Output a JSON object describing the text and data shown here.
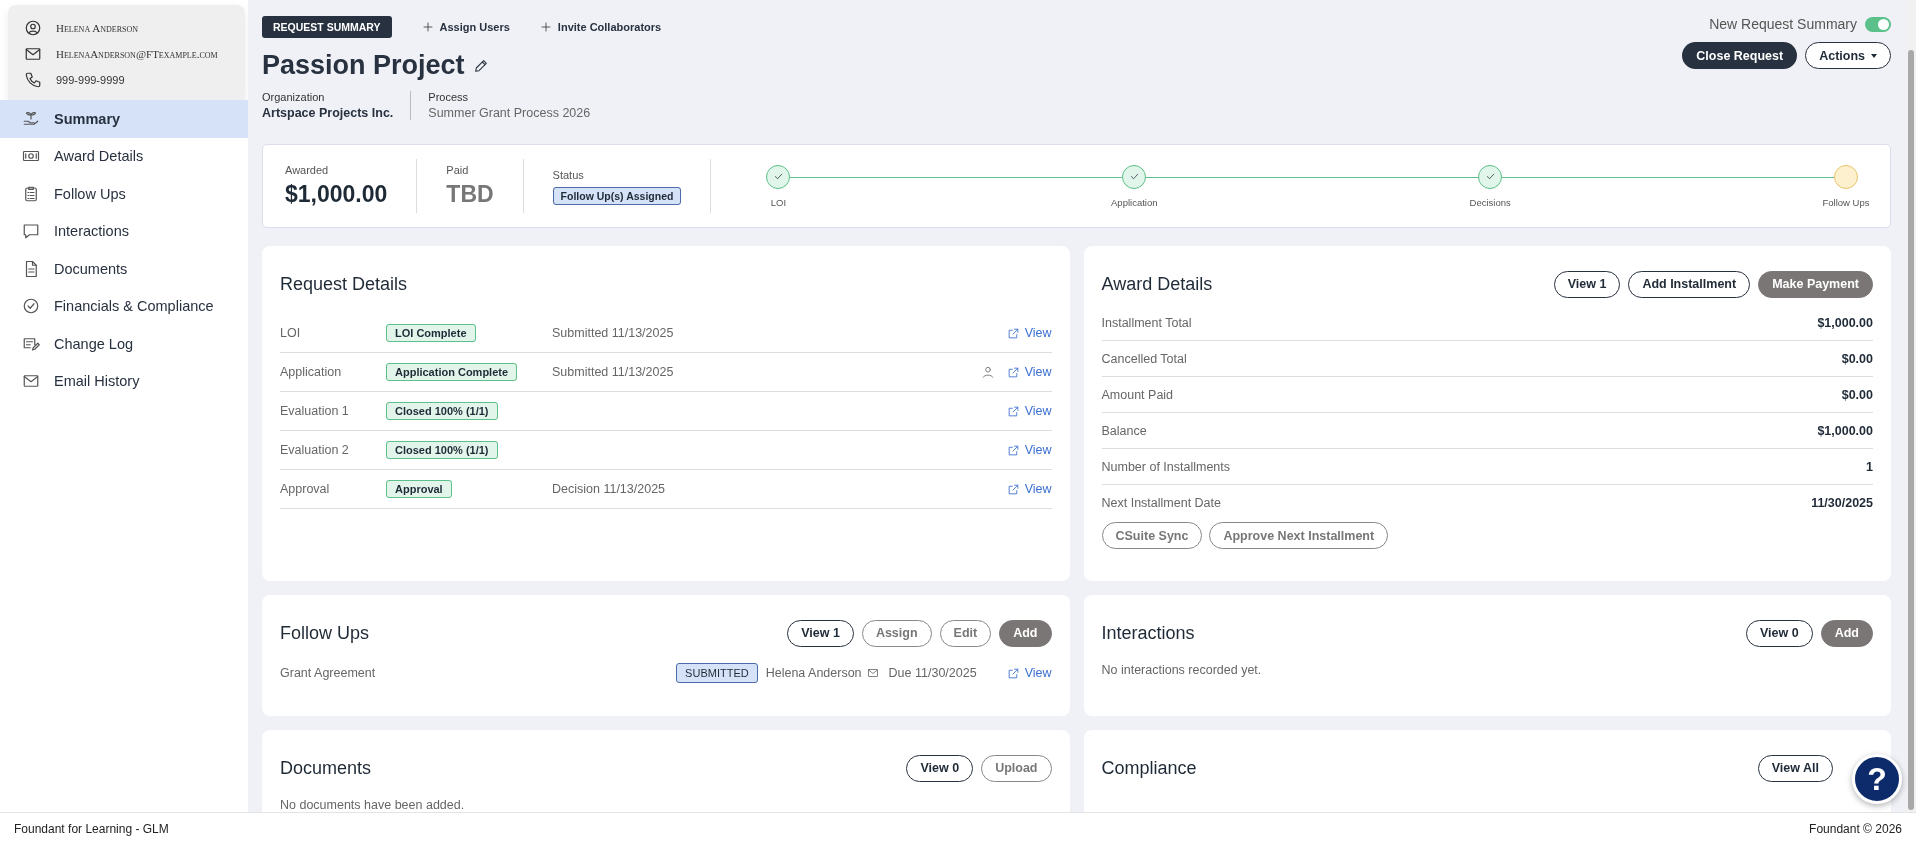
{
  "profile": {
    "name": "Helena Anderson",
    "email": "HelenaAnderson@FTexample.com",
    "phone": "999-999-9999"
  },
  "sidebar": {
    "items": [
      {
        "label": "Summary",
        "kind": "plant",
        "selected": true
      },
      {
        "label": "Award Details",
        "kind": "money",
        "selected": false
      },
      {
        "label": "Follow Ups",
        "kind": "clipboard",
        "selected": false
      },
      {
        "label": "Interactions",
        "kind": "chat",
        "selected": false
      },
      {
        "label": "Documents",
        "kind": "document",
        "selected": false
      },
      {
        "label": "Financials & Compliance",
        "kind": "check",
        "selected": false
      },
      {
        "label": "Change Log",
        "kind": "editlist",
        "selected": false
      },
      {
        "label": "Email History",
        "kind": "mail",
        "selected": false
      }
    ]
  },
  "header": {
    "badge": "REQUEST SUMMARY",
    "actions": [
      "Assign Users",
      "Invite Collaborators"
    ],
    "title": "Passion Project",
    "fields": [
      {
        "label": "Organization",
        "value": "Artspace Projects Inc.",
        "bold": true
      },
      {
        "label": "Process",
        "value": "Summer Grant Process 2026",
        "bold": false
      }
    ],
    "toggle": {
      "label": "New Request Summary",
      "on": true
    },
    "buttons": [
      {
        "label": "Close Request",
        "kind": "primary"
      },
      {
        "label": "Actions",
        "kind": "dropdown"
      }
    ]
  },
  "summary": {
    "stats": [
      {
        "label": "Awarded",
        "value": "$1,000.00",
        "muted": false
      },
      {
        "label": "Paid",
        "value": "TBD",
        "muted": true
      }
    ],
    "status": {
      "label": "Status",
      "badge": "Follow Up(s) Assigned"
    },
    "steps": [
      {
        "label": "LOI",
        "done": true,
        "current": false
      },
      {
        "label": "Application",
        "done": true,
        "current": false
      },
      {
        "label": "Decisions",
        "done": true,
        "current": false
      },
      {
        "label": "Follow Ups",
        "done": false,
        "current": true
      }
    ]
  },
  "request_details": {
    "title": "Request Details",
    "rows": [
      {
        "name": "LOI",
        "badge": "LOI Complete",
        "note": "Submitted 11/13/2025",
        "assignee": false,
        "link": "View"
      },
      {
        "name": "Application",
        "badge": "Application Complete",
        "note": "Submitted 11/13/2025",
        "assignee": true,
        "link": "View"
      },
      {
        "name": "Evaluation 1",
        "badge": "Closed 100% (1/1)",
        "assignee": false,
        "link": "View"
      },
      {
        "name": "Evaluation 2",
        "badge": "Closed 100% (1/1)",
        "assignee": false,
        "link": "View"
      },
      {
        "name": "Approval",
        "badge": "Approval",
        "note": "Decision 11/13/2025",
        "assignee": false,
        "link": "View"
      }
    ]
  },
  "award_details": {
    "title": "Award Details",
    "buttons": [
      {
        "label": "View 1",
        "kind": "outline"
      },
      {
        "label": "Add Installment",
        "kind": "outline"
      },
      {
        "label": "Make Payment",
        "kind": "filled"
      }
    ],
    "rows": [
      {
        "label": "Installment Total",
        "value": "$1,000.00"
      },
      {
        "label": "Cancelled Total",
        "value": "$0.00"
      },
      {
        "label": "Amount Paid",
        "value": "$0.00"
      },
      {
        "label": "Balance",
        "value": "$1,000.00"
      },
      {
        "label": "Number of Installments",
        "value": "1"
      },
      {
        "label": "Next Installment Date",
        "value": "11/30/2025"
      }
    ],
    "footer_buttons": [
      {
        "label": "CSuite Sync",
        "kind": "muted"
      },
      {
        "label": "Approve Next Installment",
        "kind": "muted"
      }
    ]
  },
  "follow_ups": {
    "title": "Follow Ups",
    "buttons": [
      {
        "label": "View 1",
        "kind": "outline"
      },
      {
        "label": "Assign",
        "kind": "muted"
      },
      {
        "label": "Edit",
        "kind": "muted"
      },
      {
        "label": "Add",
        "kind": "filled"
      }
    ],
    "items": [
      {
        "name": "Grant Agreement",
        "status": "SUBMITTED",
        "assignee": "Helena Anderson",
        "due": "Due 11/30/2025",
        "link": "View"
      }
    ]
  },
  "interactions": {
    "title": "Interactions",
    "buttons": [
      {
        "label": "View 0",
        "kind": "outline"
      },
      {
        "label": "Add",
        "kind": "filled"
      }
    ],
    "empty": "No interactions recorded yet."
  },
  "documents": {
    "title": "Documents",
    "buttons": [
      {
        "label": "View 0",
        "kind": "outline"
      },
      {
        "label": "Upload",
        "kind": "muted"
      }
    ],
    "empty": "No documents have been added."
  },
  "compliance": {
    "title": "Compliance",
    "buttons": [
      {
        "label": "View All",
        "kind": "outline"
      }
    ]
  },
  "help": {
    "label": "?"
  },
  "footer": {
    "left": "Foundant for Learning - GLM",
    "right": "Foundant © 2026"
  }
}
